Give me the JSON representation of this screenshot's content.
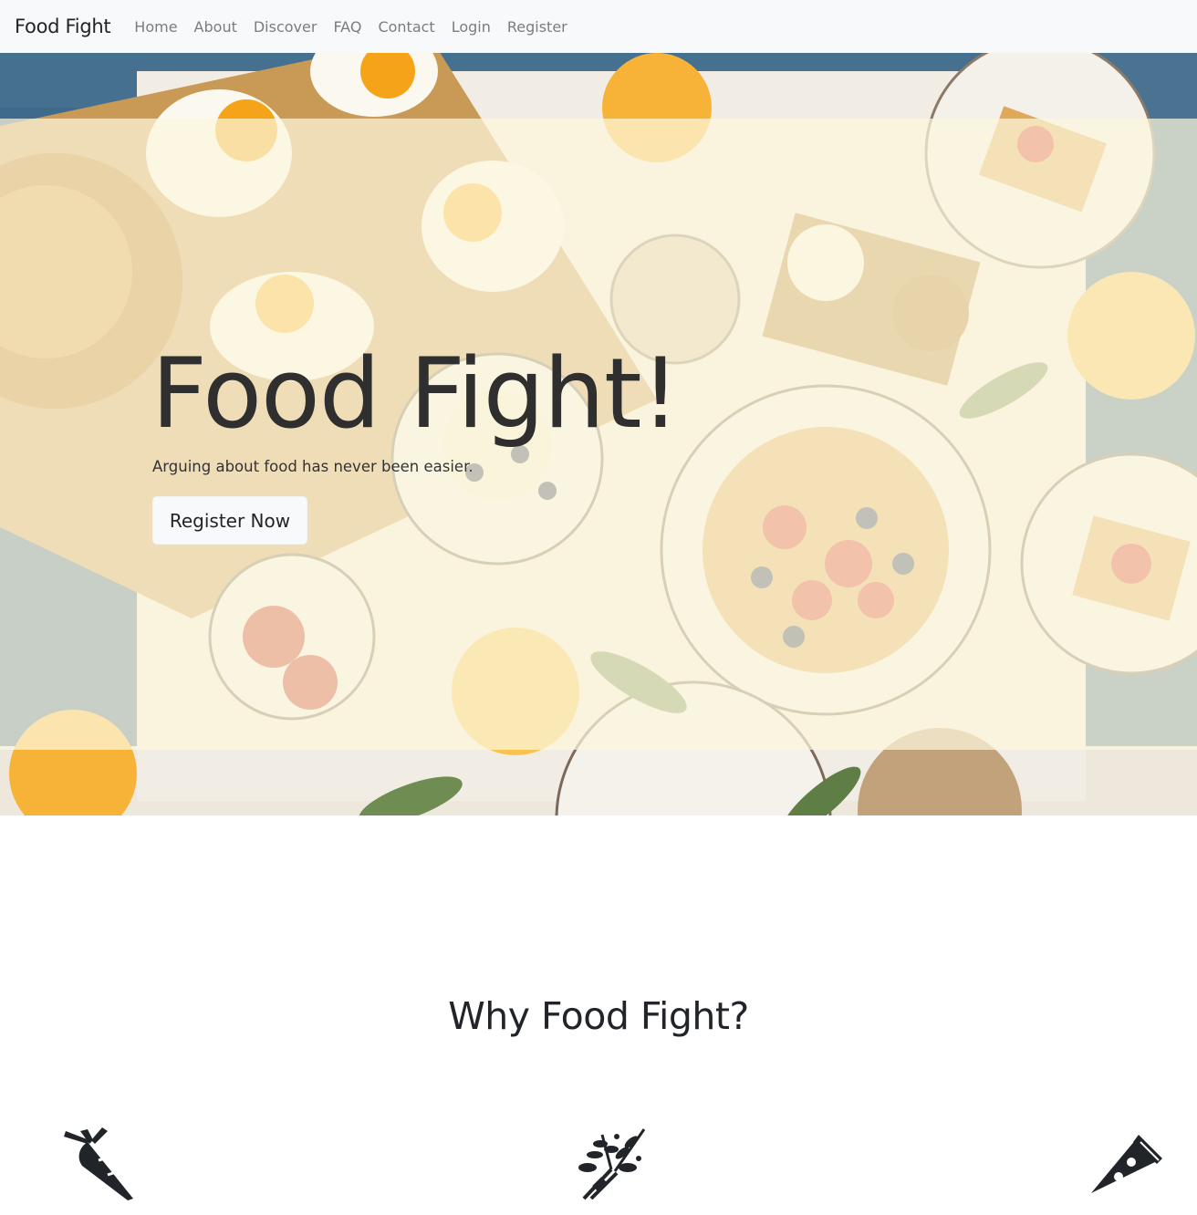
{
  "nav": {
    "brand": "Food Fight",
    "links": [
      "Home",
      "About",
      "Discover",
      "FAQ",
      "Contact",
      "Login",
      "Register"
    ]
  },
  "hero": {
    "title": "Food Fight!",
    "subtitle": "Arguing about food has never been easier.",
    "cta_label": "Register Now",
    "background_image": "breakfast table with eggs, waffles, strawberries, orange juice and coffee"
  },
  "section": {
    "title": "Why Food Fight?"
  },
  "features": [
    {
      "icon": "carrot-icon"
    },
    {
      "icon": "herbs-icon"
    },
    {
      "icon": "pizza-slice-icon"
    }
  ],
  "colors": {
    "navbar_bg": "#f8f9fa",
    "nav_link": "#7a7d80",
    "text_dark": "#212529",
    "hero_overlay": "#fcf7dc",
    "button_bg": "#f8f9fa"
  }
}
